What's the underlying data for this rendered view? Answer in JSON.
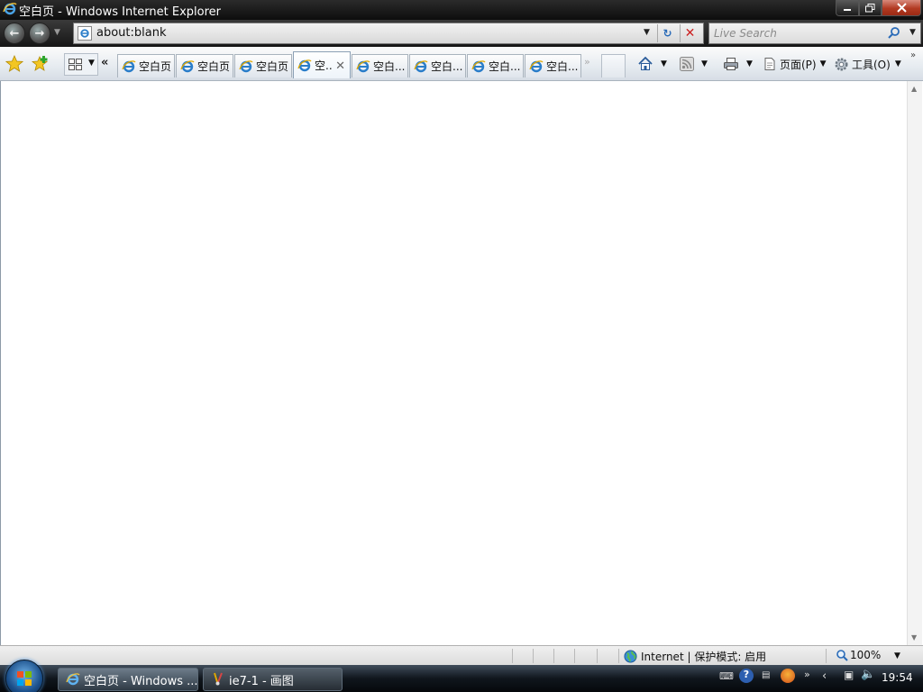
{
  "window": {
    "title": "空白页 - Windows Internet Explorer"
  },
  "navbar": {
    "address": "about:blank",
    "search_placeholder": "Live Search"
  },
  "tabs": [
    {
      "label": "空白页",
      "active": false
    },
    {
      "label": "空白页",
      "active": false
    },
    {
      "label": "空白页",
      "active": false
    },
    {
      "label": "空..",
      "active": true
    },
    {
      "label": "空白...",
      "active": false
    },
    {
      "label": "空白...",
      "active": false
    },
    {
      "label": "空白...",
      "active": false
    },
    {
      "label": "空白...",
      "active": false
    }
  ],
  "commandbar": {
    "page_label": "页面(P)",
    "tools_label": "工具(O)"
  },
  "statusbar": {
    "zone": "Internet | 保护模式: 启用",
    "zoom": "100%"
  },
  "taskbar": {
    "items": [
      {
        "label": "空白页 - Windows ...",
        "icon": "ie-icon"
      },
      {
        "label": "ie7-1 - 画图",
        "icon": "paint-icon"
      }
    ],
    "clock": "19:54"
  }
}
